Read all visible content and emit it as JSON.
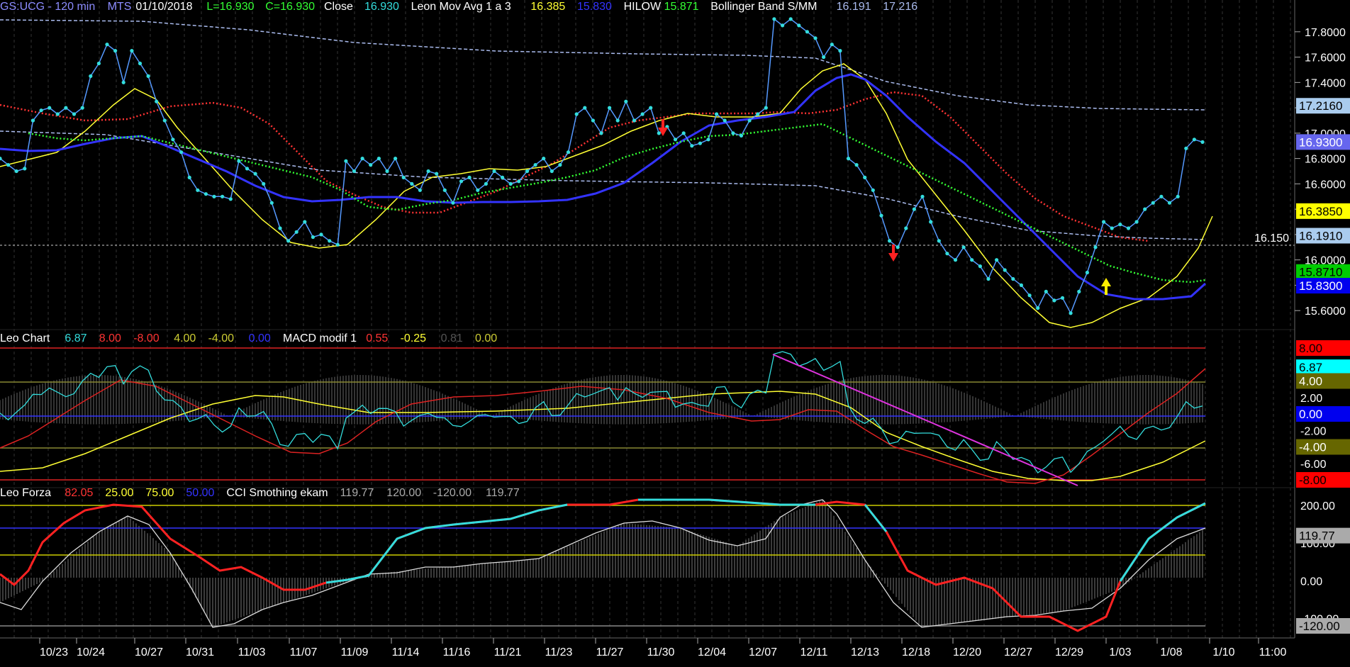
{
  "header": {
    "panel1": [
      {
        "text": "GS:UCG - 120 min",
        "color": "#8c8cff"
      },
      {
        "text": "MTS",
        "color": "#8c8cff"
      },
      {
        "text": "01/10/2018",
        "color": "#ffffff"
      },
      {
        "text": "L=16.930",
        "color": "#33ff33"
      },
      {
        "text": "C=16.930",
        "color": "#33ff33"
      },
      {
        "text": "Close",
        "color": "#ffffff"
      },
      {
        "text": "16.930",
        "color": "#33dddd"
      },
      {
        "text": "Leon Mov Avg 1 a 3",
        "color": "#ffffff"
      },
      {
        "text": "16.385",
        "color": "#ffff33"
      },
      {
        "text": "15.830",
        "color": "#3333ff"
      },
      {
        "text": "HILOW",
        "color": "#ffffff"
      },
      {
        "text": "15.871",
        "color": "#33ff33"
      },
      {
        "text": "Bollinger Band S/MM",
        "color": "#ffffff"
      },
      {
        "text": "16.191",
        "color": "#aabbee"
      },
      {
        "text": "17.216",
        "color": "#aabbee"
      }
    ],
    "panel2": [
      {
        "text": "Leo Chart",
        "color": "#ffffff"
      },
      {
        "text": "6.87",
        "color": "#33dddd"
      },
      {
        "text": "8.00",
        "color": "#ff3333"
      },
      {
        "text": "-8.00",
        "color": "#ff3333"
      },
      {
        "text": "4.00",
        "color": "#cccc33"
      },
      {
        "text": "-4.00",
        "color": "#cccc33"
      },
      {
        "text": "0.00",
        "color": "#3333ff"
      },
      {
        "text": "MACD modif 1",
        "color": "#ffffff"
      },
      {
        "text": "0.55",
        "color": "#ff3333"
      },
      {
        "text": "-0.25",
        "color": "#ffff33"
      },
      {
        "text": "0.81",
        "color": "#555555"
      },
      {
        "text": "0.00",
        "color": "#cccc33"
      }
    ],
    "panel3": [
      {
        "text": "Leo Forza",
        "color": "#ffffff"
      },
      {
        "text": "82.05",
        "color": "#ff3333"
      },
      {
        "text": "25.00",
        "color": "#ffff33"
      },
      {
        "text": "75.00",
        "color": "#ffff33"
      },
      {
        "text": "50.00",
        "color": "#3333ff"
      },
      {
        "text": "CCI Smothing ekam",
        "color": "#ffffff"
      },
      {
        "text": "119.77",
        "color": "#aaaaaa"
      },
      {
        "text": "120.00",
        "color": "#aaaaaa"
      },
      {
        "text": "-120.00",
        "color": "#aaaaaa"
      },
      {
        "text": "119.77",
        "color": "#aaaaaa"
      }
    ]
  },
  "price_axis": {
    "ticks": [
      "17.8000",
      "17.6000",
      "17.4000",
      "17.2000",
      "17.0000",
      "16.8000",
      "16.6000",
      "16.4000",
      "16.2000",
      "16.0000",
      "15.8000",
      "15.6000"
    ],
    "tick_values": [
      17.8,
      17.6,
      17.4,
      17.2,
      17.0,
      16.8,
      16.6,
      16.4,
      16.2,
      16.0,
      15.8,
      15.6
    ],
    "badges": [
      {
        "text": "17.2160",
        "value": 17.216,
        "bg": "#aaccee",
        "fg": "#000000"
      },
      {
        "text": "16.9300",
        "value": 16.93,
        "bg": "#6666ee",
        "fg": "#ffffff"
      },
      {
        "text": "16.3850",
        "value": 16.385,
        "bg": "#ffff00",
        "fg": "#000000"
      },
      {
        "text": "16.1910",
        "value": 16.191,
        "bg": "#aaccee",
        "fg": "#000000"
      },
      {
        "text": "15.8710",
        "value": 15.871,
        "bg": "#00cc00",
        "fg": "#000000"
      },
      {
        "text": "15.8300",
        "value": 15.83,
        "bg": "#0000ee",
        "fg": "#ffffff"
      }
    ],
    "cursor_label": "16.150",
    "cursor_value": 16.15
  },
  "osc1_axis": {
    "ticks": [
      "8.00",
      "6.00",
      "4.00",
      "2.00",
      "0.00",
      "-2.00",
      "-4.00",
      "-6.00",
      "-8.00"
    ],
    "tick_values": [
      8,
      6,
      4,
      2,
      0,
      -2,
      -4,
      -6,
      -8
    ],
    "badges": [
      {
        "text": "8.00",
        "value": 8,
        "bg": "#ff0000",
        "fg": "#000000"
      },
      {
        "text": "6.87",
        "value": 6.87,
        "bg": "#00ffff",
        "fg": "#000000"
      },
      {
        "text": "4.00",
        "value": 4,
        "bg": "#666600",
        "fg": "#ffffff"
      },
      {
        "text": "0.00",
        "value": 0,
        "bg": "#0000ee",
        "fg": "#ffffff"
      },
      {
        "text": "-4.00",
        "value": -4,
        "bg": "#666600",
        "fg": "#ffffff"
      },
      {
        "text": "-8.00",
        "value": -8,
        "bg": "#ff0000",
        "fg": "#000000"
      }
    ]
  },
  "osc2_axis": {
    "ticks": [
      "200.00",
      "100.00",
      "0.00",
      "-100.00"
    ],
    "tick_values": [
      200,
      100,
      0,
      -100
    ],
    "badges": [
      {
        "text": "119.77",
        "value": 119.77,
        "bg": "#aaaaaa",
        "fg": "#000000"
      },
      {
        "text": "-120.00",
        "value": -120,
        "bg": "#aaaaaa",
        "fg": "#000000"
      }
    ]
  },
  "x_axis": {
    "labels": [
      "10/23",
      "10/24",
      "10/27",
      "10/31",
      "11/03",
      "11/07",
      "11/09",
      "11/14",
      "11/16",
      "11/21",
      "11/23",
      "11/27",
      "11/30",
      "12/04",
      "12/07",
      "12/11",
      "12/13",
      "12/18",
      "12/20",
      "12/27",
      "12/29",
      "1/03",
      "1/08",
      "1/10",
      "11:00"
    ]
  },
  "chart_data": {
    "type": "line",
    "x_labels": [
      "10/23",
      "10/24",
      "10/27",
      "10/31",
      "11/03",
      "11/07",
      "11/09",
      "11/14",
      "11/16",
      "11/21",
      "11/23",
      "11/27",
      "11/30",
      "12/04",
      "12/07",
      "12/11",
      "12/13",
      "12/18",
      "12/20",
      "12/27",
      "12/29",
      "1/03",
      "1/08",
      "1/10",
      "11:00"
    ],
    "price": {
      "name": "Close",
      "ylim": [
        15.45,
        17.95
      ],
      "values": [
        16.8,
        16.75,
        16.7,
        16.72,
        17.1,
        17.18,
        17.2,
        17.15,
        17.2,
        17.15,
        17.2,
        17.45,
        17.55,
        17.7,
        17.65,
        17.4,
        17.65,
        17.55,
        17.45,
        17.25,
        17.1,
        16.95,
        16.85,
        16.65,
        16.55,
        16.52,
        16.5,
        16.5,
        16.48,
        16.78,
        16.72,
        16.68,
        16.6,
        16.45,
        16.25,
        16.15,
        16.22,
        16.3,
        16.18,
        16.2,
        16.15,
        16.12,
        16.78,
        16.7,
        16.8,
        16.75,
        16.8,
        16.7,
        16.8,
        16.65,
        16.6,
        16.55,
        16.7,
        16.68,
        16.55,
        16.45,
        16.62,
        16.65,
        16.55,
        16.6,
        16.7,
        16.65,
        16.6,
        16.62,
        16.7,
        16.75,
        16.8,
        16.7,
        16.75,
        16.85,
        17.15,
        17.2,
        17.1,
        17.0,
        17.2,
        17.1,
        17.25,
        17.1,
        17.15,
        17.2,
        17.0,
        17.05,
        16.95,
        17.0,
        16.9,
        16.92,
        16.95,
        17.15,
        17.1,
        17.0,
        16.98,
        17.1,
        17.15,
        17.2,
        17.9,
        17.85,
        17.9,
        17.85,
        17.8,
        17.75,
        17.6,
        17.7,
        17.65,
        16.8,
        16.75,
        16.65,
        16.55,
        16.35,
        16.15,
        16.1,
        16.25,
        16.4,
        16.5,
        16.3,
        16.15,
        16.05,
        16.0,
        16.1,
        16.0,
        15.95,
        15.85,
        16.0,
        15.92,
        15.85,
        15.8,
        15.72,
        15.62,
        15.75,
        15.68,
        15.7,
        15.58,
        15.75,
        15.9,
        16.1,
        16.3,
        16.25,
        16.28,
        16.25,
        16.3,
        16.4,
        16.45,
        16.5,
        16.45,
        16.5,
        16.88,
        16.95,
        16.93
      ],
      "overlays": [
        {
          "name": "Leon Mov Avg 1 a 3 (yellow)",
          "color": "#ffff33",
          "value": 16.385
        },
        {
          "name": "Leon Mov Avg 1 a 3 (blue)",
          "color": "#3333ff",
          "value": 15.83
        },
        {
          "name": "HILOW",
          "color": "#33ff33",
          "value": 15.871
        },
        {
          "name": "Bollinger Band S/MM",
          "color": "#aabbee",
          "values": [
            16.191,
            17.216
          ]
        }
      ]
    },
    "oscillator1": {
      "name": "Leo Chart",
      "ylim": [
        -8.5,
        8.5
      ],
      "last": 6.87,
      "levels": [
        8,
        4,
        0,
        -4,
        -8
      ]
    },
    "oscillator2": {
      "name": "Leo Forza",
      "ylim": [
        -130,
        215
      ],
      "last": 119.77,
      "levels": [
        200,
        120,
        75,
        -120
      ]
    }
  }
}
